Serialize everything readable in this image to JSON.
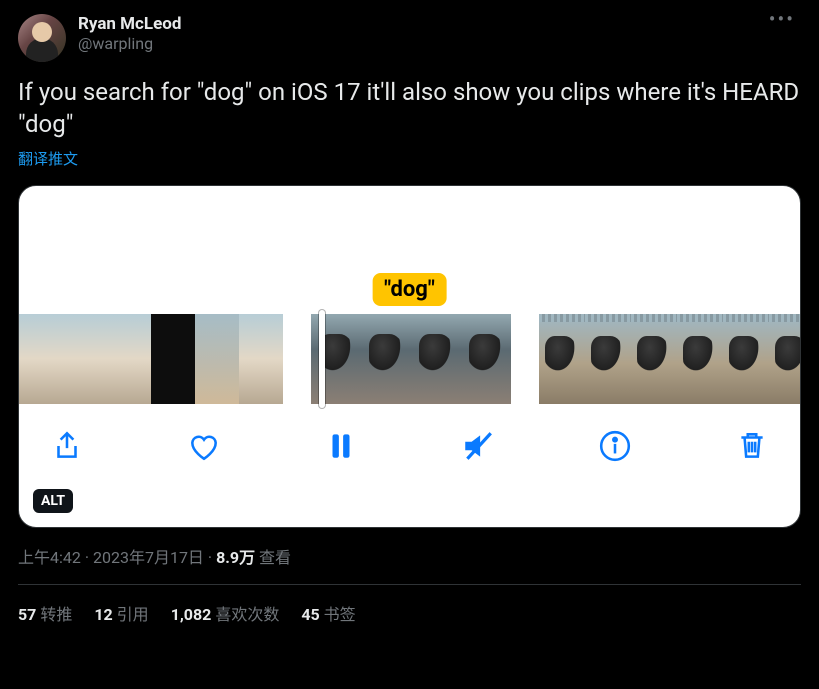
{
  "author": {
    "display_name": "Ryan McLeod",
    "handle": "@warpling"
  },
  "tweet_text": "If you search for \"dog\" on iOS 17 it'll also show you clips where it's HEARD \"dog\"",
  "translate_label": "翻译推文",
  "media": {
    "caption_label": "\"dog\"",
    "alt_badge": "ALT"
  },
  "meta": {
    "time": "上午4:42",
    "separator": " · ",
    "date": "2023年7月17日",
    "views_number": "8.9万",
    "views_label": " 查看"
  },
  "stats": {
    "retweets_num": "57",
    "retweets_label": " 转推",
    "quotes_num": "12",
    "quotes_label": " 引用",
    "likes_num": "1,082",
    "likes_label": " 喜欢次数",
    "bookmarks_num": "45",
    "bookmarks_label": " 书签"
  }
}
